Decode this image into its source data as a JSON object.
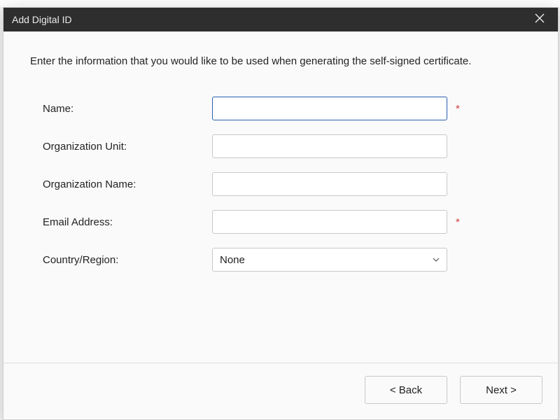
{
  "dialog": {
    "title": "Add Digital ID",
    "instructions": "Enter the information that you would like to be used when generating the self-signed certificate.",
    "fields": {
      "name": {
        "label": "Name:",
        "value": "",
        "required": true
      },
      "orgUnit": {
        "label": "Organization Unit:",
        "value": "",
        "required": false
      },
      "orgName": {
        "label": "Organization Name:",
        "value": "",
        "required": false
      },
      "email": {
        "label": "Email Address:",
        "value": "",
        "required": true
      },
      "country": {
        "label": "Country/Region:",
        "value": "None",
        "required": false
      }
    },
    "required_marker": "*",
    "buttons": {
      "back": "< Back",
      "next": "Next >"
    }
  }
}
